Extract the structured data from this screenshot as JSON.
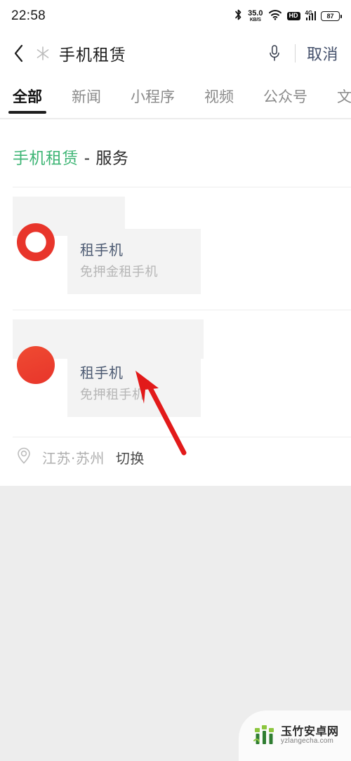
{
  "statusbar": {
    "time": "22:58",
    "netspeed_value": "35.0",
    "netspeed_unit": "KB/S",
    "hd_label": "HD",
    "network_label": "4G",
    "battery_level": "87",
    "icons": [
      "bluetooth-icon",
      "wifi-icon",
      "hd-icon",
      "signal-icon",
      "battery-icon"
    ]
  },
  "searchbar": {
    "back_icon": "back-chevron-icon",
    "sparkle_icon": "sparkle-icon",
    "query": "手机租赁",
    "mic_icon": "microphone-icon",
    "cancel_label": "取消"
  },
  "tabs": [
    {
      "label": "全部",
      "active": true
    },
    {
      "label": "新闻",
      "active": false
    },
    {
      "label": "小程序",
      "active": false
    },
    {
      "label": "视频",
      "active": false
    },
    {
      "label": "公众号",
      "active": false
    },
    {
      "label": "文",
      "active": false
    }
  ],
  "section": {
    "keyword": "手机租赁",
    "suffix": " - 服务"
  },
  "results": [
    {
      "logo": "jd-logo-icon",
      "title": "租手机",
      "subtitle": "免押金租手机"
    },
    {
      "logo": "red-circle-logo-icon",
      "title": "租手机",
      "subtitle": "免押租手机"
    }
  ],
  "location": {
    "pin_icon": "location-pin-icon",
    "name": "江苏·苏州",
    "switch_label": "切换"
  },
  "watermark": {
    "icon": "bamboo-logo-icon",
    "name": "玉竹安卓网",
    "url": "yzlangecha.com"
  },
  "colors": {
    "accent_green": "#3eb575",
    "arrow_red": "#e21a1a",
    "brand_red": "#e8352b",
    "page_bg": "#ededed",
    "panel_bg": "#ffffff"
  }
}
